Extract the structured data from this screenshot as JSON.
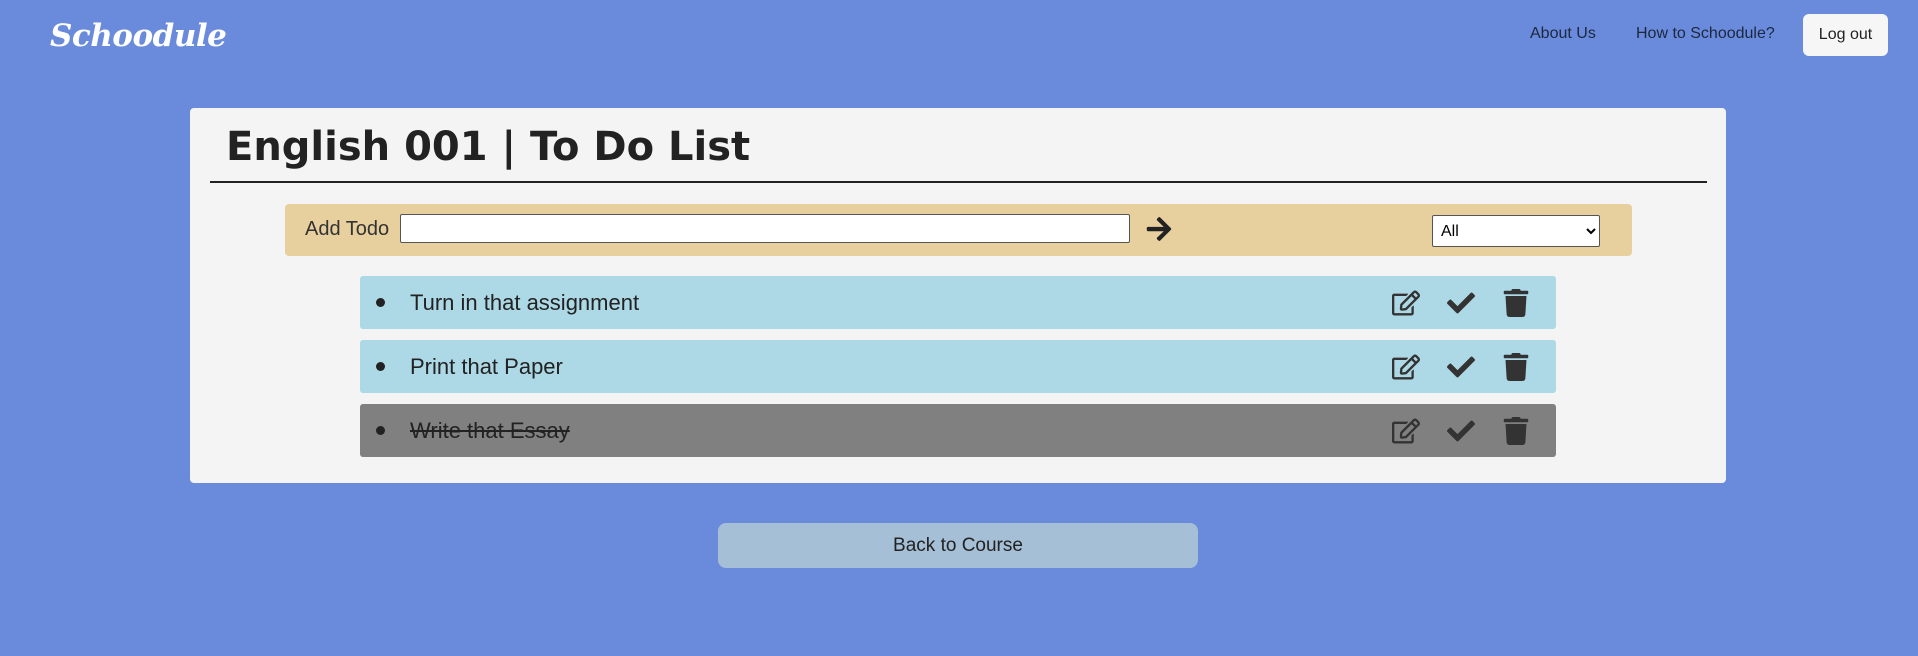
{
  "navbar": {
    "brand": "Schoodule",
    "links": [
      {
        "label": "About Us"
      },
      {
        "label": "How to Schoodule?"
      }
    ],
    "logout_label": "Log out"
  },
  "page": {
    "title": "English 001 | To Do List"
  },
  "add_todo": {
    "label": "Add Todo",
    "input_value": "",
    "submit_icon": "arrow-right-icon",
    "filter_selected": "All"
  },
  "todos": [
    {
      "text": "Turn in that assignment",
      "completed": false
    },
    {
      "text": "Print that Paper",
      "completed": false
    },
    {
      "text": "Write that Essay",
      "completed": true
    }
  ],
  "back_button": "Back to Course",
  "colors": {
    "background": "#6a8bdb",
    "card": "#f4f4f4",
    "add_bar": "#e8cf9e",
    "todo_pending": "#add8e6",
    "todo_completed": "#808080",
    "back_button": "#a5bfd6"
  }
}
